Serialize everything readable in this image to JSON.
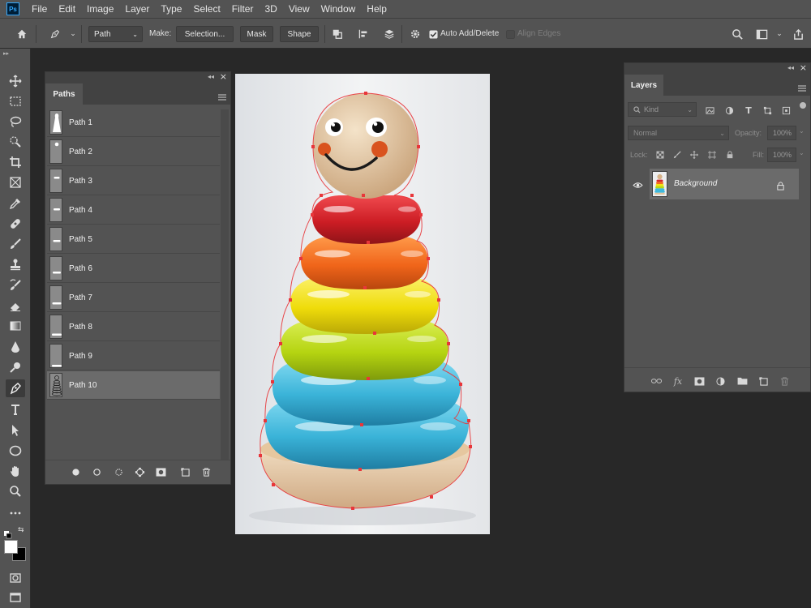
{
  "app": {
    "logo": "Ps"
  },
  "menu": [
    "File",
    "Edit",
    "Image",
    "Layer",
    "Type",
    "Select",
    "Filter",
    "3D",
    "View",
    "Window",
    "Help"
  ],
  "options": {
    "mode_value": "Path",
    "make_label": "Make:",
    "selection_label": "Selection...",
    "mask_label": "Mask",
    "shape_label": "Shape",
    "auto_add_delete_label": "Auto Add/Delete",
    "auto_add_delete_checked": true,
    "align_edges_label": "Align Edges"
  },
  "paths_panel": {
    "tab": "Paths",
    "paths": [
      {
        "name": "Path 1",
        "selected": false
      },
      {
        "name": "Path 2",
        "selected": false
      },
      {
        "name": "Path 3",
        "selected": false
      },
      {
        "name": "Path 4",
        "selected": false
      },
      {
        "name": "Path 5",
        "selected": false
      },
      {
        "name": "Path 6",
        "selected": false
      },
      {
        "name": "Path 7",
        "selected": false
      },
      {
        "name": "Path 8",
        "selected": false
      },
      {
        "name": "Path 9",
        "selected": false
      },
      {
        "name": "Path 10",
        "selected": true
      }
    ]
  },
  "layers_panel": {
    "tab": "Layers",
    "kind_placeholder": "Kind",
    "blend_mode": "Normal",
    "opacity_label": "Opacity:",
    "opacity_value": "100%",
    "lock_label": "Lock:",
    "fill_label": "Fill:",
    "fill_value": "100%",
    "layer_name": "Background"
  },
  "colors": {
    "accent": "#31a8ff",
    "path_anchor": "#e8363a",
    "ring_red": "#d7262b",
    "ring_orange": "#f26a1b",
    "ring_yellow": "#f2e211",
    "ring_lime": "#b8d813",
    "ring_blue": "#3fb8dc",
    "wood": "#e2c49c"
  }
}
